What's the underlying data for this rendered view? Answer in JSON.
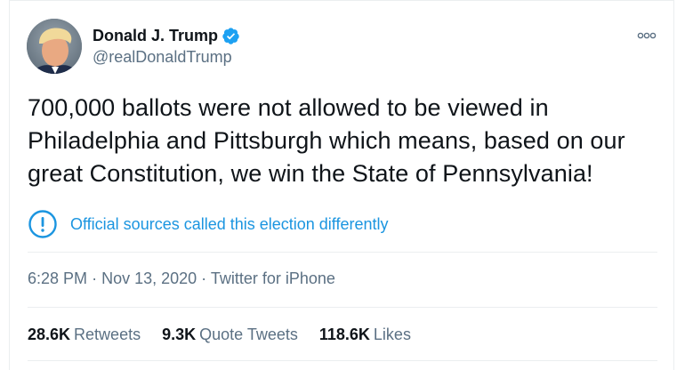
{
  "author": {
    "display_name": "Donald J. Trump",
    "handle": "@realDonaldTrump",
    "verified": true
  },
  "tweet": {
    "text": "700,000 ballots were not allowed to be viewed in Philadelphia and Pittsburgh which means, based on our great Constitution, we win the State of Pennsylvania!"
  },
  "notice": {
    "text": "Official sources called this election differently"
  },
  "meta": {
    "time": "6:28 PM",
    "separator": "·",
    "date": "Nov 13, 2020",
    "source": "Twitter for iPhone"
  },
  "stats": {
    "retweets_count": "28.6K",
    "retweets_label": "Retweets",
    "quotes_count": "9.3K",
    "quotes_label": "Quote Tweets",
    "likes_count": "118.6K",
    "likes_label": "Likes"
  },
  "colors": {
    "accent": "#1b95e0",
    "verified": "#1da1f2",
    "secondary_text": "#5b7083",
    "primary_text": "#0f1419",
    "divider": "#ebeef0"
  },
  "icons": {
    "verified": "verified-badge-icon",
    "more": "more-options-icon",
    "notice": "exclamation-circle-icon"
  }
}
